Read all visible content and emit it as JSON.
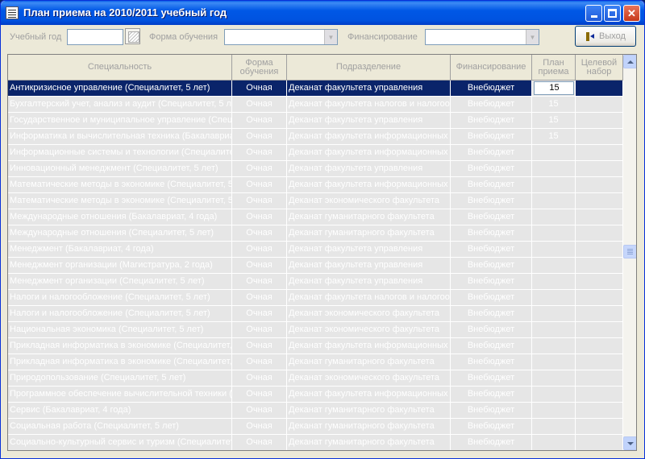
{
  "window": {
    "title": "План приема на 2010/2011 учебный год"
  },
  "toolbar": {
    "year_label": "Учебный год",
    "year_value": "",
    "form_label": "Форма обучения",
    "form_value": "",
    "financing_label": "Финансирование",
    "financing_value": "",
    "exit_label": "Выход"
  },
  "grid": {
    "columns": [
      "Специальность",
      "Форма обучения",
      "Подразделение",
      "Финансирование",
      "План приема",
      "Целевой набор"
    ],
    "selected_plan_value": "15",
    "rows": [
      {
        "specialty": "Антикризисное управление (Специалитет, 5 лет)",
        "form": "Очная",
        "department": "Деканат факультета управления",
        "financing": "Внебюджет",
        "plan": "15",
        "target": ""
      },
      {
        "specialty": "Бухгалтерский учет, анализ и аудит (Специалитет, 5 лет)",
        "form": "Очная",
        "department": "Деканат факультета налогов и налогообложения",
        "financing": "Внебюджет",
        "plan": "15",
        "target": ""
      },
      {
        "specialty": "Государственное и муниципальное управление (Специалитет, 5 лет)",
        "form": "Очная",
        "department": "Деканат факультета управления",
        "financing": "Внебюджет",
        "plan": "15",
        "target": ""
      },
      {
        "specialty": "Информатика и вычислительная техника (Бакалавриат, 4 года)",
        "form": "Очная",
        "department": "Деканат факультета информационных технологий",
        "financing": "Внебюджет",
        "plan": "15",
        "target": ""
      },
      {
        "specialty": "Информационные системы и технологии (Специалитет, 5 лет)",
        "form": "Очная",
        "department": "Деканат факультета информационных технологий",
        "financing": "Внебюджет",
        "plan": "",
        "target": ""
      },
      {
        "specialty": "Инновационный менеджмент (Специалитет, 5 лет)",
        "form": "Очная",
        "department": "Деканат факультета управления",
        "financing": "Внебюджет",
        "plan": "",
        "target": ""
      },
      {
        "specialty": "Математические методы в экономике (Специалитет, 5 лет)",
        "form": "Очная",
        "department": "Деканат факультета информационных технологий",
        "financing": "Внебюджет",
        "plan": "",
        "target": ""
      },
      {
        "specialty": "Математические методы в экономике (Специалитет, 5 лет)",
        "form": "Очная",
        "department": "Деканат экономического факультета",
        "financing": "Внебюджет",
        "plan": "",
        "target": ""
      },
      {
        "specialty": "Международные отношения (Бакалавриат, 4 года)",
        "form": "Очная",
        "department": "Деканат гуманитарного факультета",
        "financing": "Внебюджет",
        "plan": "",
        "target": ""
      },
      {
        "specialty": "Международные отношения (Специалитет, 5 лет)",
        "form": "Очная",
        "department": "Деканат гуманитарного факультета",
        "financing": "Внебюджет",
        "plan": "",
        "target": ""
      },
      {
        "specialty": "Менеджмент (Бакалавриат, 4 года)",
        "form": "Очная",
        "department": "Деканат факультета управления",
        "financing": "Внебюджет",
        "plan": "",
        "target": ""
      },
      {
        "specialty": "Менеджмент организации (Магистратура, 2 года)",
        "form": "Очная",
        "department": "Деканат факультета управления",
        "financing": "Внебюджет",
        "plan": "",
        "target": ""
      },
      {
        "specialty": "Менеджмент организации (Специалитет, 5 лет)",
        "form": "Очная",
        "department": "Деканат факультета управления",
        "financing": "Внебюджет",
        "plan": "",
        "target": ""
      },
      {
        "specialty": "Налоги и налогообложение (Специалитет, 5 лет)",
        "form": "Очная",
        "department": "Деканат факультета налогов и налогообложения",
        "financing": "Внебюджет",
        "plan": "",
        "target": ""
      },
      {
        "specialty": "Налоги и налогообложение (Специалитет, 5 лет)",
        "form": "Очная",
        "department": "Деканат экономического факультета",
        "financing": "Внебюджет",
        "plan": "",
        "target": ""
      },
      {
        "specialty": "Национальная экономика (Специалитет, 5 лет)",
        "form": "Очная",
        "department": "Деканат экономического факультета",
        "financing": "Внебюджет",
        "plan": "",
        "target": ""
      },
      {
        "specialty": "Прикладная информатика в экономике (Специалитет, 5 лет)",
        "form": "Очная",
        "department": "Деканат факультета информационных технологий",
        "financing": "Внебюджет",
        "plan": "",
        "target": ""
      },
      {
        "specialty": "Прикладная информатика в экономике (Специалитет, 5 лет)",
        "form": "Очная",
        "department": "Деканат гуманитарного факультета",
        "financing": "Внебюджет",
        "plan": "",
        "target": ""
      },
      {
        "specialty": "Природопользование (Специалитет, 5 лет)",
        "form": "Очная",
        "department": "Деканат экономического факультета",
        "financing": "Внебюджет",
        "plan": "",
        "target": ""
      },
      {
        "specialty": "Программное обеспечение вычислительной техники (Специалитет, 5 лет)",
        "form": "Очная",
        "department": "Деканат факультета информационных технологий",
        "financing": "Внебюджет",
        "plan": "",
        "target": ""
      },
      {
        "specialty": "Сервис (Бакалавриат, 4 года)",
        "form": "Очная",
        "department": "Деканат гуманитарного факультета",
        "financing": "Внебюджет",
        "plan": "",
        "target": ""
      },
      {
        "specialty": "Социальная работа (Специалитет, 5 лет)",
        "form": "Очная",
        "department": "Деканат гуманитарного факультета",
        "financing": "Внебюджет",
        "plan": "",
        "target": ""
      },
      {
        "specialty": "Социально-культурный сервис и туризм (Специалитет, 5 лет)",
        "form": "Очная",
        "department": "Деканат гуманитарного факультета",
        "financing": "Внебюджет",
        "plan": "",
        "target": ""
      }
    ]
  }
}
